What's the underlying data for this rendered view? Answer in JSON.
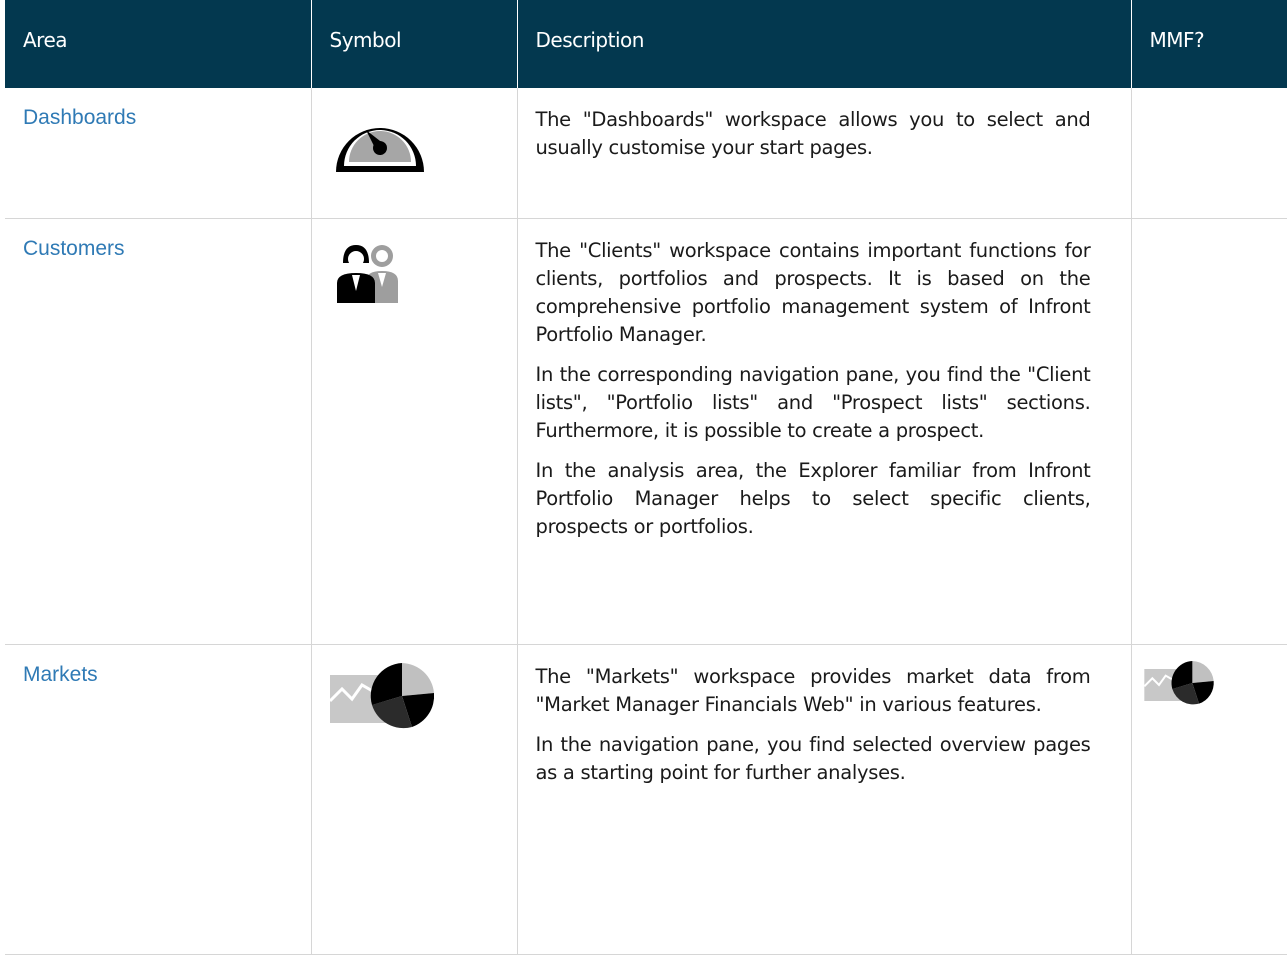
{
  "table": {
    "headers": {
      "area": "Area",
      "symbol": "Symbol",
      "description": "Description",
      "mmf": "MMF?"
    },
    "rows": [
      {
        "area": "Dashboards",
        "symbol_icon": "speedometer-icon",
        "description": [
          "The \"Dashboards\" workspace allows you to select and usually customise your start pages."
        ],
        "mmf_icon": null
      },
      {
        "area": "Customers",
        "symbol_icon": "clients-icon",
        "description": [
          "The \"Clients\" workspace contains important functions for clients, portfolios and prospects. It is based on the comprehensive portfolio management system of Infront Portfolio Manager.",
          "In the corresponding navigation pane, you find the \"Client lists\", \"Portfolio lists\" and \"Prospect lists\" sections. Furthermore, it is possible to create a prospect.",
          "In the analysis area, the Explorer familiar from Infront Portfolio Manager helps to select specific clients, prospects or portfolios."
        ],
        "mmf_icon": null
      },
      {
        "area": "Markets",
        "symbol_icon": "markets-chart-icon",
        "description": [
          "The \"Markets\" workspace provides market data from \"Market Manager Financials Web\" in various features.",
          "In the navigation pane, you find selected overview pages as a starting point for further analyses."
        ],
        "mmf_icon": "markets-chart-icon"
      }
    ]
  },
  "colors": {
    "header_bg": "#03384f",
    "header_text": "#ffffff",
    "link": "#2f7ab5",
    "grid": "#d6d6d6"
  }
}
